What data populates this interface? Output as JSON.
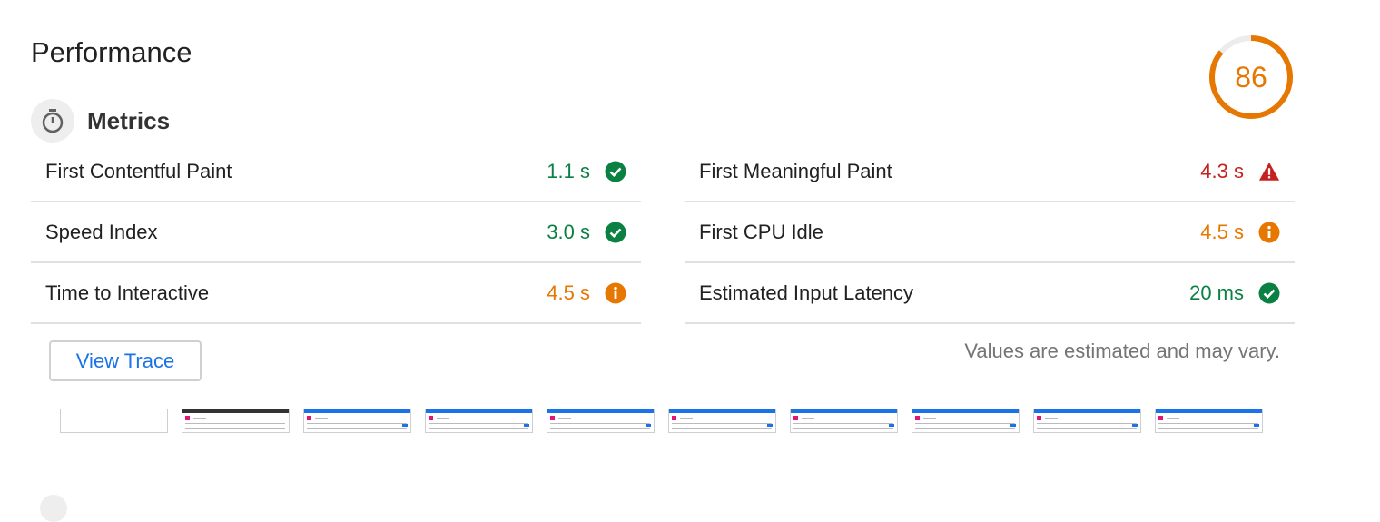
{
  "section": {
    "title": "Performance"
  },
  "score": {
    "value": "86",
    "fraction": 0.86,
    "color": "#e67700"
  },
  "metrics": {
    "heading": "Metrics",
    "icon": "stopwatch-icon",
    "left": [
      {
        "name": "First Contentful Paint",
        "value": "1.1 s",
        "status": "pass"
      },
      {
        "name": "Speed Index",
        "value": "3.0 s",
        "status": "pass"
      },
      {
        "name": "Time to Interactive",
        "value": "4.5 s",
        "status": "average"
      }
    ],
    "right": [
      {
        "name": "First Meaningful Paint",
        "value": "4.3 s",
        "status": "fail"
      },
      {
        "name": "First CPU Idle",
        "value": "4.5 s",
        "status": "average"
      },
      {
        "name": "Estimated Input Latency",
        "value": "20 ms",
        "status": "pass"
      }
    ]
  },
  "actions": {
    "view_trace": "View Trace"
  },
  "note": "Values are estimated and may vary.",
  "colors": {
    "pass": "#0b8043",
    "average": "#e67700",
    "fail": "#c5221f",
    "link": "#1a73e8"
  },
  "filmstrip": {
    "frames": [
      {
        "state": "blank"
      },
      {
        "state": "dark-header"
      },
      {
        "state": "loaded"
      },
      {
        "state": "loaded"
      },
      {
        "state": "loaded"
      },
      {
        "state": "loaded"
      },
      {
        "state": "loaded"
      },
      {
        "state": "loaded"
      },
      {
        "state": "loaded"
      },
      {
        "state": "loaded"
      }
    ]
  }
}
